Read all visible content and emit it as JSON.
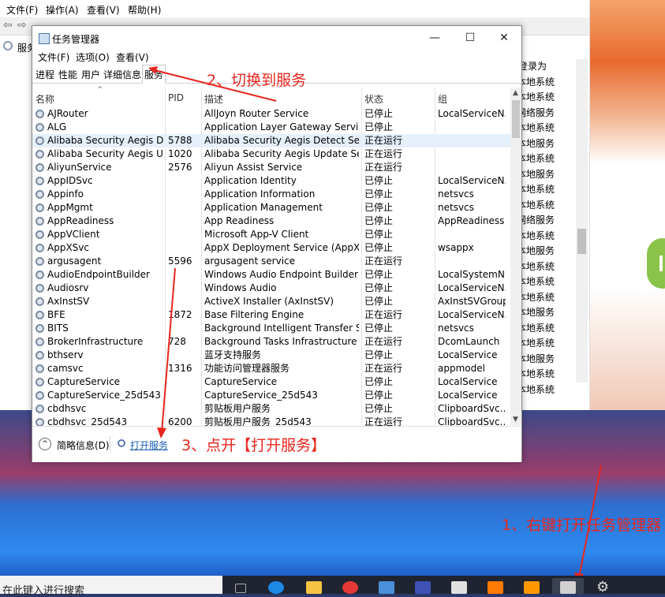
{
  "background_window": {
    "menu": [
      "文件(F)",
      "操作(A)",
      "查看(V)",
      "帮助(H)"
    ],
    "tab_label": "服务",
    "column_header": "登录为",
    "column_values": [
      "本地系统",
      "本地系统",
      "网络服务",
      "本地系统",
      "本地服务",
      "本地系统",
      "本地服务",
      "本地系统",
      "本地系统",
      "网络服务",
      "本地系统",
      "本地服务",
      "本地系统",
      "本地系统",
      "本地系统",
      "本地服务",
      "本地系统",
      "本地系统",
      "本地服务",
      "本地系统",
      "本地系统"
    ]
  },
  "task_manager": {
    "title": "任务管理器",
    "minimize": "—",
    "maximize": "☐",
    "close": "✕",
    "menu": [
      "文件(F)",
      "选项(O)",
      "查看(V)"
    ],
    "tabs": [
      "进程",
      "性能",
      "用户",
      "详细信息",
      "服务"
    ],
    "active_tab": "服务",
    "columns": {
      "name": "名称",
      "pid": "PID",
      "desc": "描述",
      "status": "状态",
      "group": "组"
    },
    "rows": [
      {
        "name": "AJRouter",
        "pid": "",
        "desc": "AllJoyn Router Service",
        "status": "已停止",
        "group": "LocalServiceN..."
      },
      {
        "name": "ALG",
        "pid": "",
        "desc": "Application Layer Gateway Service",
        "status": "已停止",
        "group": ""
      },
      {
        "name": "Alibaba Security Aegis De...",
        "pid": "5788",
        "desc": "Alibaba Security Aegis Detect Serv...",
        "status": "正在运行",
        "group": ""
      },
      {
        "name": "Alibaba Security Aegis Up...",
        "pid": "1020",
        "desc": "Alibaba Security Aegis Update Ser...",
        "status": "正在运行",
        "group": ""
      },
      {
        "name": "AliyunService",
        "pid": "2576",
        "desc": "Aliyun Assist Service",
        "status": "正在运行",
        "group": ""
      },
      {
        "name": "AppIDSvc",
        "pid": "",
        "desc": "Application Identity",
        "status": "已停止",
        "group": "LocalServiceN..."
      },
      {
        "name": "Appinfo",
        "pid": "",
        "desc": "Application Information",
        "status": "已停止",
        "group": "netsvcs"
      },
      {
        "name": "AppMgmt",
        "pid": "",
        "desc": "Application Management",
        "status": "已停止",
        "group": "netsvcs"
      },
      {
        "name": "AppReadiness",
        "pid": "",
        "desc": "App Readiness",
        "status": "已停止",
        "group": "AppReadiness"
      },
      {
        "name": "AppVClient",
        "pid": "",
        "desc": "Microsoft App-V Client",
        "status": "已停止",
        "group": ""
      },
      {
        "name": "AppXSvc",
        "pid": "",
        "desc": "AppX Deployment Service (AppXS...",
        "status": "已停止",
        "group": "wsappx"
      },
      {
        "name": "argusagent",
        "pid": "5596",
        "desc": "argusagent service",
        "status": "正在运行",
        "group": ""
      },
      {
        "name": "AudioEndpointBuilder",
        "pid": "",
        "desc": "Windows Audio Endpoint Builder",
        "status": "已停止",
        "group": "LocalSystemN..."
      },
      {
        "name": "Audiosrv",
        "pid": "",
        "desc": "Windows Audio",
        "status": "已停止",
        "group": "LocalServiceN..."
      },
      {
        "name": "AxInstSV",
        "pid": "",
        "desc": "ActiveX Installer (AxInstSV)",
        "status": "已停止",
        "group": "AxInstSVGroup"
      },
      {
        "name": "BFE",
        "pid": "1872",
        "desc": "Base Filtering Engine",
        "status": "正在运行",
        "group": "LocalServiceN..."
      },
      {
        "name": "BITS",
        "pid": "",
        "desc": "Background Intelligent Transfer Se...",
        "status": "已停止",
        "group": "netsvcs"
      },
      {
        "name": "BrokerInfrastructure",
        "pid": "728",
        "desc": "Background Tasks Infrastructure S...",
        "status": "正在运行",
        "group": "DcomLaunch"
      },
      {
        "name": "bthserv",
        "pid": "",
        "desc": "蓝牙支持服务",
        "status": "已停止",
        "group": "LocalService"
      },
      {
        "name": "camsvc",
        "pid": "1316",
        "desc": "功能访问管理器服务",
        "status": "正在运行",
        "group": "appmodel"
      },
      {
        "name": "CaptureService",
        "pid": "",
        "desc": "CaptureService",
        "status": "已停止",
        "group": "LocalService"
      },
      {
        "name": "CaptureService_25d543",
        "pid": "",
        "desc": "CaptureService_25d543",
        "status": "已停止",
        "group": "LocalService"
      },
      {
        "name": "cbdhsvc",
        "pid": "",
        "desc": "剪贴板用户服务",
        "status": "已停止",
        "group": "ClipboardSvc..."
      },
      {
        "name": "cbdhsvc_25d543",
        "pid": "6200",
        "desc": "剪贴板用户服务_25d543",
        "status": "正在运行",
        "group": "ClipboardSvc..."
      }
    ],
    "footer": {
      "less_details": "简略信息(D)",
      "open_services": "打开服务"
    }
  },
  "annotations": {
    "step1": "1、右键打开任务管理器",
    "step2": "2、切换到服务",
    "step3": "3、点开【打开服务】",
    "color": "#e8261e"
  },
  "taskbar": {
    "search_placeholder": "在此键入进行搜索"
  }
}
